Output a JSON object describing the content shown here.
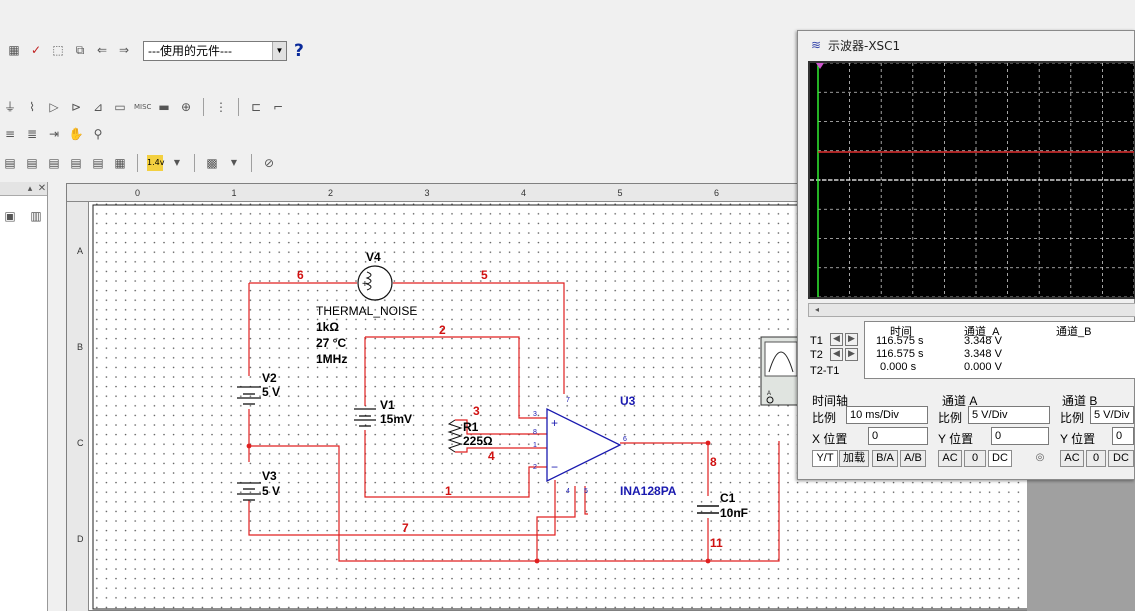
{
  "toolbar": {
    "component_select": "---使用的元件---",
    "help": "?"
  },
  "scope": {
    "title": "示波器-XSC1",
    "readout": {
      "headers": [
        "时间",
        "通道_A",
        "通道_B"
      ],
      "rows": [
        {
          "label": "T1",
          "time": "116.575 s",
          "a": "3.348 V",
          "b": ""
        },
        {
          "label": "T2",
          "time": "116.575 s",
          "a": "3.348 V",
          "b": ""
        },
        {
          "label": "T2-T1",
          "time": "0.000 s",
          "a": "0.000 V",
          "b": ""
        }
      ]
    },
    "timebase": {
      "title": "时间轴",
      "scale_label": "比例",
      "scale": "10 ms/Div",
      "pos_label": "X 位置",
      "pos": "0"
    },
    "chA": {
      "title": "通道 A",
      "scale_label": "比例",
      "scale": "5 V/Div",
      "pos_label": "Y 位置",
      "pos": "0"
    },
    "chB": {
      "title": "通道 B",
      "scale_label": "比例",
      "scale": "5 V/Div",
      "pos_label": "Y 位置",
      "pos": "0"
    },
    "buttons": {
      "yt": "Y/T",
      "add": "加载",
      "ba": "B/A",
      "ab": "A/B",
      "ac": "AC",
      "zero": "0",
      "dc": "DC"
    }
  },
  "ruler": {
    "top": [
      "0",
      "1",
      "2",
      "3",
      "4",
      "5",
      "6"
    ],
    "left": [
      "A",
      "B",
      "C",
      "D"
    ]
  },
  "schematic": {
    "v4": {
      "name": "V4",
      "model": "THERMAL_NOISE",
      "r": "1kΩ",
      "t": "27 °C",
      "f": "1MHz"
    },
    "v1": {
      "name": "V1",
      "val": "15mV"
    },
    "v2": {
      "name": "V2",
      "val": "5 V"
    },
    "v3": {
      "name": "V3",
      "val": "5 V"
    },
    "r1": {
      "name": "R1",
      "val": "225Ω"
    },
    "u3": {
      "name": "U3",
      "part": "INA128PA"
    },
    "c1": {
      "name": "C1",
      "val": "10nF"
    },
    "nets": [
      "6",
      "5",
      "2",
      "3",
      "4",
      "1",
      "7",
      "8",
      "11"
    ],
    "pins": [
      "3",
      "8",
      "1",
      "2",
      "7",
      "6",
      "4",
      "5"
    ],
    "pin_signs": [
      "+",
      "−"
    ]
  },
  "colors": {
    "wire": "#e02020",
    "part": "#1a1ab0",
    "net": "#d01010",
    "trace": "#e03030",
    "grid": "#ffffff"
  }
}
